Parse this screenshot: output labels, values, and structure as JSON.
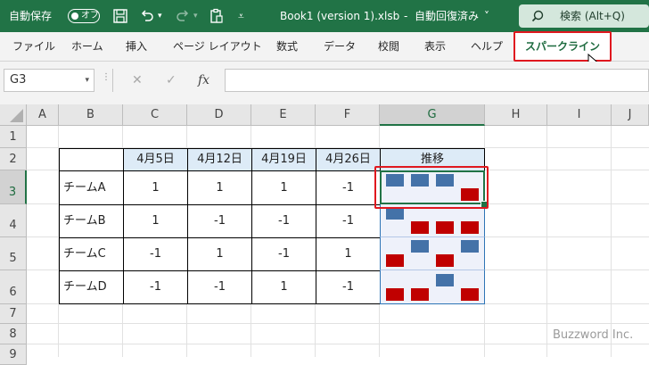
{
  "titlebar": {
    "autosave_label": "自動保存",
    "autosave_state": "オフ",
    "filename": "Book1 (version 1).xlsb",
    "separator": "-",
    "status": "自動回復済み",
    "status_chevron": "˅",
    "search_label": "検索 (Alt+Q)",
    "icons": [
      "save-icon",
      "undo-icon",
      "redo-icon",
      "clipboard-icon",
      "customize-quick-access-icon"
    ]
  },
  "ribbon": {
    "tabs": [
      "ファイル",
      "ホーム",
      "挿入",
      "ページ レイアウト",
      "数式",
      "データ",
      "校閲",
      "表示",
      "ヘルプ",
      "スパークライン"
    ],
    "active_tab": "スパークライン"
  },
  "formula_bar": {
    "name_box": "G3",
    "dropdown": "▾",
    "cancel": "✕",
    "enter": "✓",
    "function": "fx",
    "content": ""
  },
  "grid": {
    "columns": [
      "A",
      "B",
      "C",
      "D",
      "E",
      "F",
      "G",
      "H",
      "I",
      "J"
    ],
    "rows": [
      "1",
      "2",
      "3",
      "4",
      "5",
      "6",
      "7",
      "8",
      "9"
    ],
    "selected_cell": "G3"
  },
  "table": {
    "headers": [
      "4月5日",
      "4月12日",
      "4月19日",
      "4月26日"
    ],
    "trend_header": "推移",
    "rows": [
      {
        "name": "チームA",
        "values": [
          "1",
          "1",
          "1",
          "-1"
        ],
        "spark": [
          1,
          1,
          1,
          -1
        ]
      },
      {
        "name": "チームB",
        "values": [
          "1",
          "-1",
          "-1",
          "-1"
        ],
        "spark": [
          1,
          -1,
          -1,
          -1
        ]
      },
      {
        "name": "チームC",
        "values": [
          "-1",
          "1",
          "-1",
          "1"
        ],
        "spark": [
          -1,
          1,
          -1,
          1
        ]
      },
      {
        "name": "チームD",
        "values": [
          "-1",
          "-1",
          "1",
          "-1"
        ],
        "spark": [
          -1,
          -1,
          1,
          -1
        ]
      }
    ]
  },
  "colors": {
    "positive": "#4472a8",
    "negative": "#c00000",
    "accent": "#217346",
    "highlight": "#e0181f"
  },
  "watermark": "Buzzword Inc."
}
